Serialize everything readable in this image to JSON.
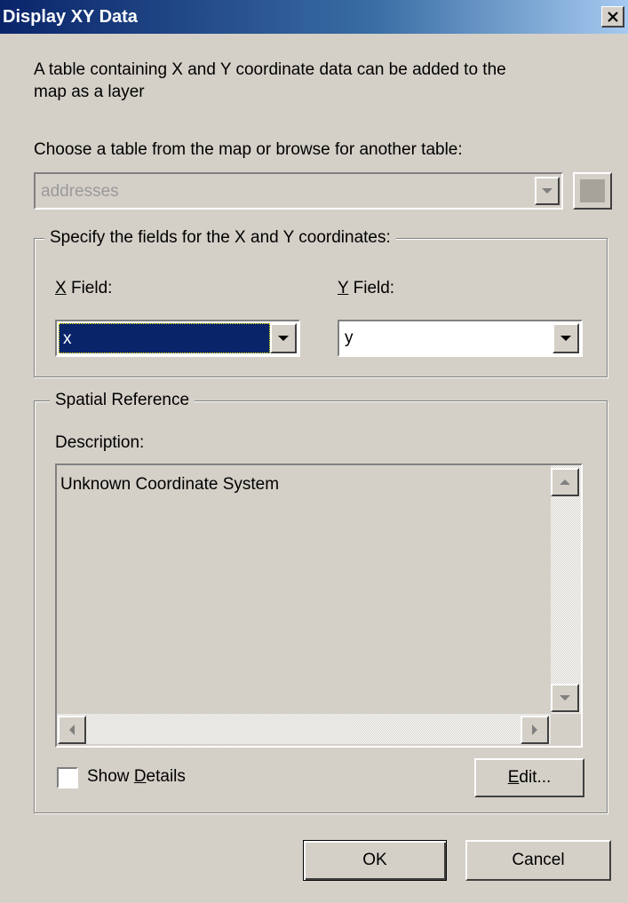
{
  "window": {
    "title": "Display XY Data"
  },
  "intro": {
    "line1": "A table containing X and Y coordinate data can be added to the",
    "line2": "map as a layer"
  },
  "table_chooser": {
    "label": "Choose a table from the map or browse for another table:",
    "selected": "addresses"
  },
  "fields_group": {
    "title": "Specify the fields for the X and Y coordinates:",
    "x_label_key": "X",
    "x_label_rest": " Field:",
    "y_label_key": "Y",
    "y_label_rest": " Field:",
    "x_value": "x",
    "y_value": "y"
  },
  "spatial_group": {
    "title": "Spatial Reference",
    "description_label": "Description:",
    "description_text": "Unknown Coordinate System"
  },
  "show_details": {
    "label_pre": "Show ",
    "label_key": "D",
    "label_post": "etails",
    "checked": false
  },
  "buttons": {
    "edit_key": "E",
    "edit_rest": "dit...",
    "ok": "OK",
    "cancel": "Cancel"
  },
  "colors": {
    "title_start": "#0a246a",
    "title_end": "#a6caf0",
    "face": "#d4d0c8",
    "selection": "#0a246a"
  },
  "icons": {
    "close": "close-icon",
    "dropdown": "chevron-down-icon",
    "browse": "browse-icon"
  }
}
